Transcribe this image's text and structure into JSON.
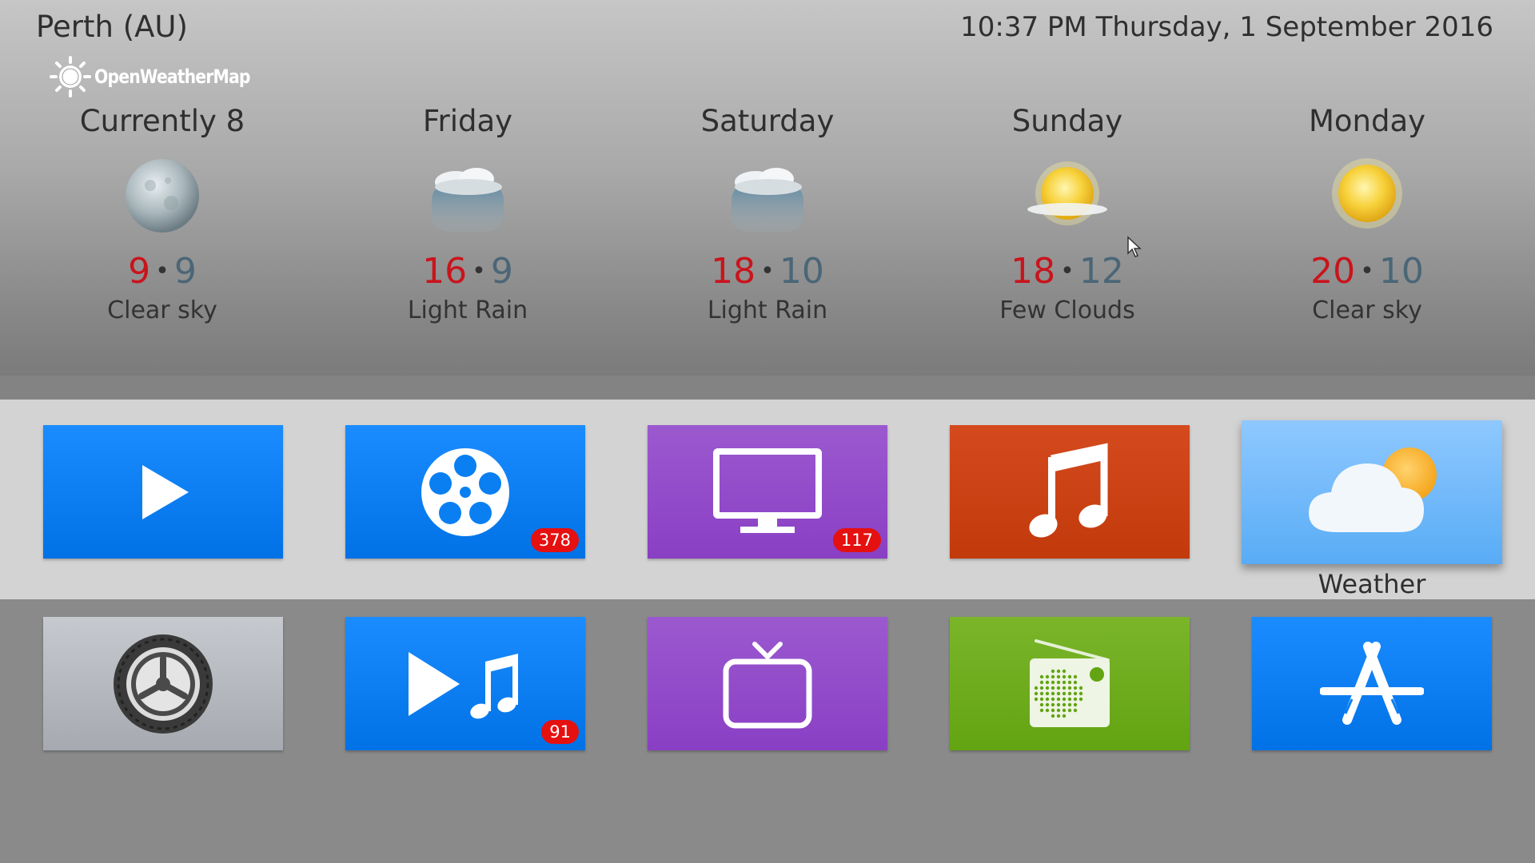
{
  "header": {
    "location": "Perth (AU)",
    "datetime": "10:37 PM Thursday, 1 September 2016",
    "provider": "OpenWeatherMap"
  },
  "forecast": [
    {
      "day": "Currently 8",
      "high": "9",
      "low": "9",
      "condition": "Clear sky",
      "icon": "moon-icon"
    },
    {
      "day": "Friday",
      "high": "16",
      "low": "9",
      "condition": "Light Rain",
      "icon": "rain-cloud-icon"
    },
    {
      "day": "Saturday",
      "high": "18",
      "low": "10",
      "condition": "Light Rain",
      "icon": "rain-cloud-icon"
    },
    {
      "day": "Sunday",
      "high": "18",
      "low": "12",
      "condition": "Few Clouds",
      "icon": "sun-cloud-icon"
    },
    {
      "day": "Monday",
      "high": "20",
      "low": "10",
      "condition": "Clear sky",
      "icon": "sun-icon"
    }
  ],
  "separator": "•",
  "tiles": [
    {
      "name": "videos",
      "icon": "play-icon",
      "color": "#0a7ff2",
      "badge": ""
    },
    {
      "name": "movies",
      "icon": "film-reel-icon",
      "color": "#0a7ff2",
      "badge": "378"
    },
    {
      "name": "tv-shows",
      "icon": "monitor-icon",
      "color": "#9148ca",
      "badge": "117"
    },
    {
      "name": "music",
      "icon": "music-note-icon",
      "color": "#cc4214",
      "badge": ""
    },
    {
      "name": "weather",
      "icon": "weather-cloud-sun-icon",
      "color": "#6db8fb",
      "badge": "",
      "label": "Weather"
    },
    {
      "name": "settings",
      "icon": "gear-icon",
      "color": "#b4b8be",
      "badge": ""
    },
    {
      "name": "music-videos",
      "icon": "play-music-icon",
      "color": "#0a7ff2",
      "badge": "91"
    },
    {
      "name": "live-tv",
      "icon": "tv-icon",
      "color": "#9148ca",
      "badge": ""
    },
    {
      "name": "radio",
      "icon": "radio-icon",
      "color": "#6fad1e",
      "badge": ""
    },
    {
      "name": "add-ons",
      "icon": "app-store-icon",
      "color": "#0a7ff2",
      "badge": ""
    }
  ]
}
